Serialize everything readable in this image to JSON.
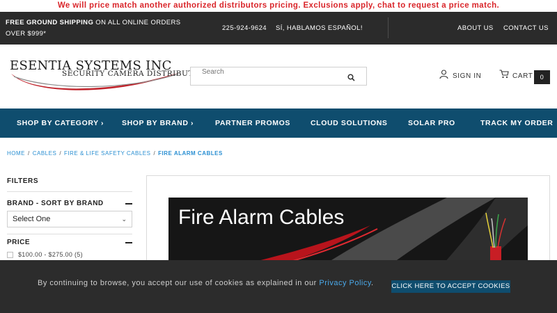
{
  "promo": {
    "text": "We will price match another authorized distributors pricing. Exclusions apply, chat to request a price match."
  },
  "topbar": {
    "shipping_bold": "FREE GROUND SHIPPING",
    "shipping_rest": "ON ALL ONLINE ORDERS OVER $999*",
    "phone": "225-924-9624",
    "spanish": "SÍ, HABLAMOS ESPAÑOL!",
    "about": "ABOUT US",
    "contact": "CONTACT US"
  },
  "logo": {
    "brand": "ESENTIA SYSTEMS INC",
    "tagline": "SECURITY CAMERA DISTRIBUTOR"
  },
  "search": {
    "placeholder": "Search",
    "icon": "search-icon"
  },
  "account": {
    "signin": "SIGN IN",
    "cart": "CART",
    "cart_count": "0"
  },
  "nav": {
    "items": [
      {
        "label": "SHOP BY CATEGORY ›"
      },
      {
        "label": "SHOP BY BRAND ›"
      },
      {
        "label": "PARTNER PROMOS"
      },
      {
        "label": "CLOUD SOLUTIONS"
      },
      {
        "label": "SOLAR PRO"
      },
      {
        "label": "TRACK MY ORDER"
      }
    ]
  },
  "breadcrumb": {
    "items": [
      "HOME",
      "CABLES",
      "FIRE & LIFE SAFETY CABLES"
    ],
    "current": "FIRE ALARM CABLES"
  },
  "sidebar": {
    "title": "FILTERS",
    "brand_heading": "BRAND - SORT BY BRAND",
    "brand_select": "Select One",
    "price_heading": "PRICE",
    "price_range": "$100.00 - $275.00 (5)"
  },
  "banner": {
    "title": "Fire Alarm Cables"
  },
  "cookie": {
    "message": "By continuing to browse, you accept our use of cookies as explained in our",
    "link": "Privacy Policy",
    "button": "CLICK HERE TO ACCEPT COOKIES"
  },
  "colors": {
    "promo_red": "#d9252a",
    "nav_blue": "#0f4d6e",
    "link_blue": "#2a8fd2",
    "topbar_dark": "#2b2b2b"
  }
}
